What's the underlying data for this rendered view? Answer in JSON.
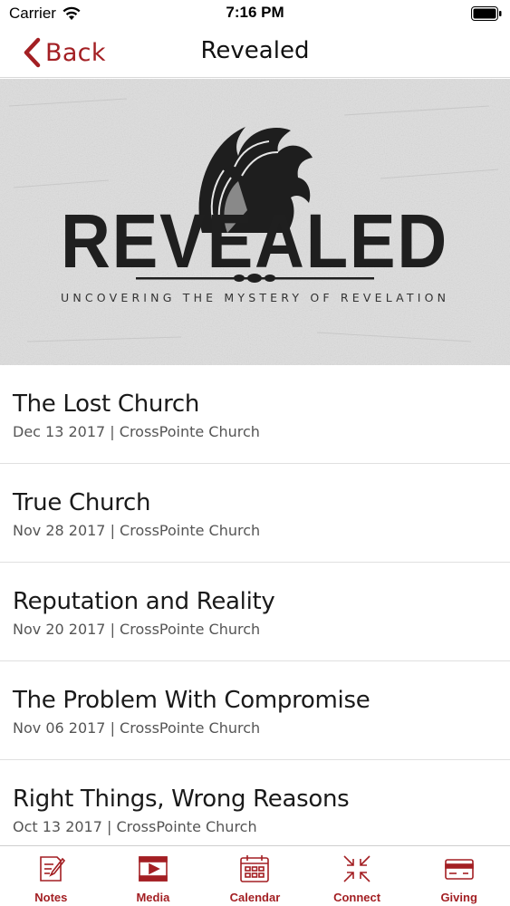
{
  "status_bar": {
    "carrier": "Carrier",
    "time": "7:16 PM",
    "wifi_icon": "wifi-icon",
    "battery_icon": "battery-icon"
  },
  "nav": {
    "back_label": "Back",
    "title": "Revealed",
    "accent_color": "#a31f23"
  },
  "banner": {
    "title": "REVEALED",
    "subtitle": "UNCOVERING THE MYSTERY OF REVELATION",
    "logo_icon": "lion-head-icon"
  },
  "sermons": [
    {
      "title": "The Lost Church",
      "meta": "Dec 13 2017 | CrossPointe Church"
    },
    {
      "title": "True Church",
      "meta": "Nov 28 2017 | CrossPointe Church"
    },
    {
      "title": "Reputation and Reality",
      "meta": "Nov 20 2017 | CrossPointe Church"
    },
    {
      "title": "The Problem With Compromise",
      "meta": "Nov 06 2017 | CrossPointe Church"
    },
    {
      "title": "Right Things, Wrong Reasons",
      "meta": "Oct 13 2017 | CrossPointe Church"
    }
  ],
  "tabs": [
    {
      "label": "Notes",
      "icon": "notes-icon"
    },
    {
      "label": "Media",
      "icon": "media-icon"
    },
    {
      "label": "Calendar",
      "icon": "calendar-icon"
    },
    {
      "label": "Connect",
      "icon": "connect-icon"
    },
    {
      "label": "Giving",
      "icon": "giving-icon"
    }
  ]
}
